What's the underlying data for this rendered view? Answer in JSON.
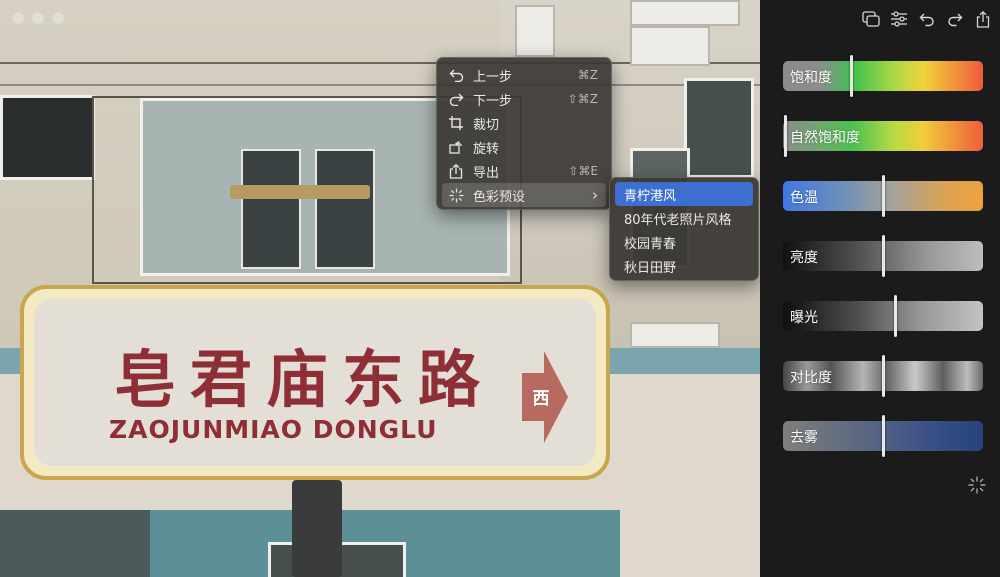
{
  "photo": {
    "sign_chinese": "皂君庙东路",
    "sign_english": "ZAOJUNMIAO DONGLU",
    "sign_direction": "西"
  },
  "context_menu": {
    "items": [
      {
        "label": "上一步",
        "shortcut": "⌘Z",
        "icon": "undo-icon"
      },
      {
        "label": "下一步",
        "shortcut": "⇧⌘Z",
        "icon": "redo-icon"
      },
      {
        "label": "裁切",
        "shortcut": "",
        "icon": "crop-icon"
      },
      {
        "label": "旋转",
        "shortcut": "",
        "icon": "rotate-icon"
      },
      {
        "label": "导出",
        "shortcut": "⇧⌘E",
        "icon": "share-icon"
      },
      {
        "label": "色彩预设",
        "shortcut": "",
        "icon": "sparkle-icon",
        "has_submenu": true,
        "chevron": "›"
      }
    ]
  },
  "submenu": {
    "items": [
      {
        "label": "青柠港风",
        "selected": true
      },
      {
        "label": "80年代老照片风格",
        "selected": false
      },
      {
        "label": "校园青春",
        "selected": false
      },
      {
        "label": "秋日田野",
        "selected": false
      }
    ]
  },
  "toolbar": {
    "buttons": [
      "compare-icon",
      "adjustments-icon",
      "undo-icon",
      "redo-icon",
      "share-icon"
    ]
  },
  "adjustments": {
    "sliders": [
      {
        "label": "饱和度",
        "value": 0.34
      },
      {
        "label": "自然饱和度",
        "value": 0.01
      },
      {
        "label": "色温",
        "value": 0.5
      },
      {
        "label": "亮度",
        "value": 0.5
      },
      {
        "label": "曝光",
        "value": 0.56
      },
      {
        "label": "对比度",
        "value": 0.5
      },
      {
        "label": "去雾",
        "value": 0.5
      }
    ],
    "auto_icon": "sparkle-icon"
  },
  "colors": {
    "selected_item": "#3d6fd1",
    "panel_background": "#1b1b1b",
    "sign_text": "#8d2f35"
  }
}
